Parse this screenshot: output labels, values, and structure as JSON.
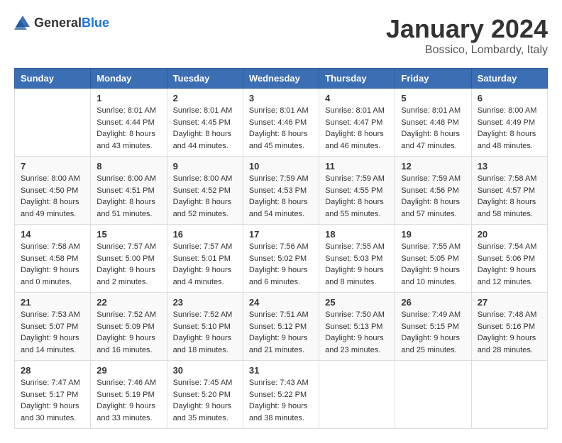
{
  "logo": {
    "text_general": "General",
    "text_blue": "Blue"
  },
  "title": "January 2024",
  "location": "Bossico, Lombardy, Italy",
  "days_of_week": [
    "Sunday",
    "Monday",
    "Tuesday",
    "Wednesday",
    "Thursday",
    "Friday",
    "Saturday"
  ],
  "weeks": [
    [
      {
        "day": "",
        "info": ""
      },
      {
        "day": "1",
        "info": "Sunrise: 8:01 AM\nSunset: 4:44 PM\nDaylight: 8 hours\nand 43 minutes."
      },
      {
        "day": "2",
        "info": "Sunrise: 8:01 AM\nSunset: 4:45 PM\nDaylight: 8 hours\nand 44 minutes."
      },
      {
        "day": "3",
        "info": "Sunrise: 8:01 AM\nSunset: 4:46 PM\nDaylight: 8 hours\nand 45 minutes."
      },
      {
        "day": "4",
        "info": "Sunrise: 8:01 AM\nSunset: 4:47 PM\nDaylight: 8 hours\nand 46 minutes."
      },
      {
        "day": "5",
        "info": "Sunrise: 8:01 AM\nSunset: 4:48 PM\nDaylight: 8 hours\nand 47 minutes."
      },
      {
        "day": "6",
        "info": "Sunrise: 8:00 AM\nSunset: 4:49 PM\nDaylight: 8 hours\nand 48 minutes."
      }
    ],
    [
      {
        "day": "7",
        "info": "Sunrise: 8:00 AM\nSunset: 4:50 PM\nDaylight: 8 hours\nand 49 minutes."
      },
      {
        "day": "8",
        "info": "Sunrise: 8:00 AM\nSunset: 4:51 PM\nDaylight: 8 hours\nand 51 minutes."
      },
      {
        "day": "9",
        "info": "Sunrise: 8:00 AM\nSunset: 4:52 PM\nDaylight: 8 hours\nand 52 minutes."
      },
      {
        "day": "10",
        "info": "Sunrise: 7:59 AM\nSunset: 4:53 PM\nDaylight: 8 hours\nand 54 minutes."
      },
      {
        "day": "11",
        "info": "Sunrise: 7:59 AM\nSunset: 4:55 PM\nDaylight: 8 hours\nand 55 minutes."
      },
      {
        "day": "12",
        "info": "Sunrise: 7:59 AM\nSunset: 4:56 PM\nDaylight: 8 hours\nand 57 minutes."
      },
      {
        "day": "13",
        "info": "Sunrise: 7:58 AM\nSunset: 4:57 PM\nDaylight: 8 hours\nand 58 minutes."
      }
    ],
    [
      {
        "day": "14",
        "info": "Sunrise: 7:58 AM\nSunset: 4:58 PM\nDaylight: 9 hours\nand 0 minutes."
      },
      {
        "day": "15",
        "info": "Sunrise: 7:57 AM\nSunset: 5:00 PM\nDaylight: 9 hours\nand 2 minutes."
      },
      {
        "day": "16",
        "info": "Sunrise: 7:57 AM\nSunset: 5:01 PM\nDaylight: 9 hours\nand 4 minutes."
      },
      {
        "day": "17",
        "info": "Sunrise: 7:56 AM\nSunset: 5:02 PM\nDaylight: 9 hours\nand 6 minutes."
      },
      {
        "day": "18",
        "info": "Sunrise: 7:55 AM\nSunset: 5:03 PM\nDaylight: 9 hours\nand 8 minutes."
      },
      {
        "day": "19",
        "info": "Sunrise: 7:55 AM\nSunset: 5:05 PM\nDaylight: 9 hours\nand 10 minutes."
      },
      {
        "day": "20",
        "info": "Sunrise: 7:54 AM\nSunset: 5:06 PM\nDaylight: 9 hours\nand 12 minutes."
      }
    ],
    [
      {
        "day": "21",
        "info": "Sunrise: 7:53 AM\nSunset: 5:07 PM\nDaylight: 9 hours\nand 14 minutes."
      },
      {
        "day": "22",
        "info": "Sunrise: 7:52 AM\nSunset: 5:09 PM\nDaylight: 9 hours\nand 16 minutes."
      },
      {
        "day": "23",
        "info": "Sunrise: 7:52 AM\nSunset: 5:10 PM\nDaylight: 9 hours\nand 18 minutes."
      },
      {
        "day": "24",
        "info": "Sunrise: 7:51 AM\nSunset: 5:12 PM\nDaylight: 9 hours\nand 21 minutes."
      },
      {
        "day": "25",
        "info": "Sunrise: 7:50 AM\nSunset: 5:13 PM\nDaylight: 9 hours\nand 23 minutes."
      },
      {
        "day": "26",
        "info": "Sunrise: 7:49 AM\nSunset: 5:15 PM\nDaylight: 9 hours\nand 25 minutes."
      },
      {
        "day": "27",
        "info": "Sunrise: 7:48 AM\nSunset: 5:16 PM\nDaylight: 9 hours\nand 28 minutes."
      }
    ],
    [
      {
        "day": "28",
        "info": "Sunrise: 7:47 AM\nSunset: 5:17 PM\nDaylight: 9 hours\nand 30 minutes."
      },
      {
        "day": "29",
        "info": "Sunrise: 7:46 AM\nSunset: 5:19 PM\nDaylight: 9 hours\nand 33 minutes."
      },
      {
        "day": "30",
        "info": "Sunrise: 7:45 AM\nSunset: 5:20 PM\nDaylight: 9 hours\nand 35 minutes."
      },
      {
        "day": "31",
        "info": "Sunrise: 7:43 AM\nSunset: 5:22 PM\nDaylight: 9 hours\nand 38 minutes."
      },
      {
        "day": "",
        "info": ""
      },
      {
        "day": "",
        "info": ""
      },
      {
        "day": "",
        "info": ""
      }
    ]
  ]
}
